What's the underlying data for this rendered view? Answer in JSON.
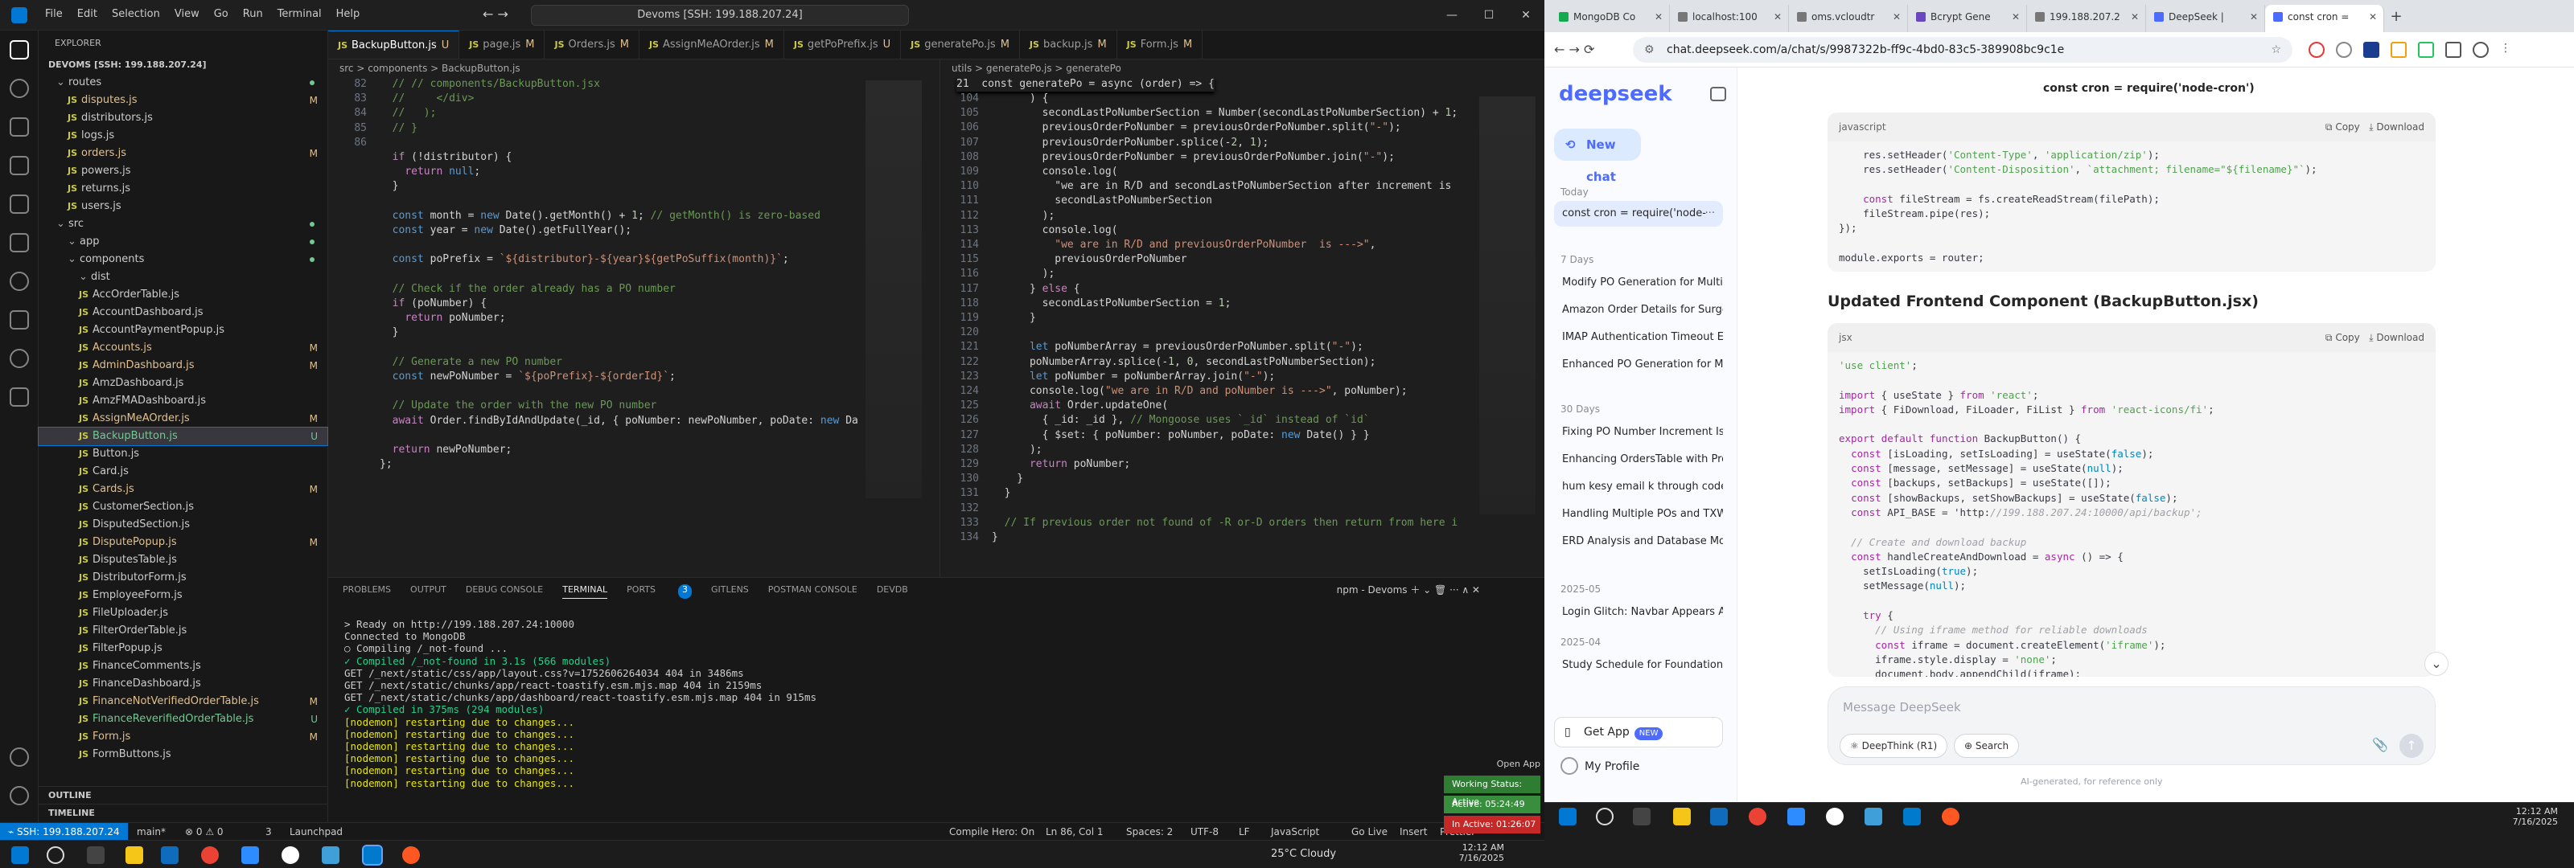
{
  "vscode": {
    "menu": [
      "File",
      "Edit",
      "Selection",
      "View",
      "Go",
      "Run",
      "Terminal",
      "Help"
    ],
    "command_center": "Devoms [SSH: 199.188.207.24]",
    "explorer": {
      "title": "EXPLORER",
      "root": "DEVOMS [SSH: 199.188.207.24]",
      "items": [
        {
          "name": "routes",
          "type": "folder",
          "depth": 1,
          "badge": "dot"
        },
        {
          "name": "disputes.js",
          "type": "js",
          "depth": 2,
          "badge": "M"
        },
        {
          "name": "distributors.js",
          "type": "js",
          "depth": 2,
          "badge": ""
        },
        {
          "name": "logs.js",
          "type": "js",
          "depth": 2,
          "badge": ""
        },
        {
          "name": "orders.js",
          "type": "js",
          "depth": 2,
          "badge": "M"
        },
        {
          "name": "powers.js",
          "type": "js",
          "depth": 2,
          "badge": ""
        },
        {
          "name": "returns.js",
          "type": "js",
          "depth": 2,
          "badge": ""
        },
        {
          "name": "users.js",
          "type": "js",
          "depth": 2,
          "badge": ""
        },
        {
          "name": "src",
          "type": "folder",
          "depth": 1,
          "badge": "dot"
        },
        {
          "name": "app",
          "type": "folder",
          "depth": 2,
          "badge": "dot"
        },
        {
          "name": "components",
          "type": "folder",
          "depth": 2,
          "badge": "dot"
        },
        {
          "name": "dist",
          "type": "folder",
          "depth": 3,
          "badge": ""
        },
        {
          "name": "AccOrderTable.js",
          "type": "js",
          "depth": 3,
          "badge": ""
        },
        {
          "name": "AccountDashboard.js",
          "type": "js",
          "depth": 3,
          "badge": ""
        },
        {
          "name": "AccountPaymentPopup.js",
          "type": "js",
          "depth": 3,
          "badge": ""
        },
        {
          "name": "Accounts.js",
          "type": "js",
          "depth": 3,
          "badge": "M"
        },
        {
          "name": "AdminDashboard.js",
          "type": "js",
          "depth": 3,
          "badge": "M"
        },
        {
          "name": "AmzDashboard.js",
          "type": "js",
          "depth": 3,
          "badge": ""
        },
        {
          "name": "AmzFMADashboard.js",
          "type": "js",
          "depth": 3,
          "badge": ""
        },
        {
          "name": "AssignMeAOrder.js",
          "type": "js",
          "depth": 3,
          "badge": "M"
        },
        {
          "name": "BackupButton.js",
          "type": "js",
          "depth": 3,
          "badge": "U"
        },
        {
          "name": "Button.js",
          "type": "js",
          "depth": 3,
          "badge": ""
        },
        {
          "name": "Card.js",
          "type": "js",
          "depth": 3,
          "badge": ""
        },
        {
          "name": "Cards.js",
          "type": "js",
          "depth": 3,
          "badge": "M"
        },
        {
          "name": "CustomerSection.js",
          "type": "js",
          "depth": 3,
          "badge": ""
        },
        {
          "name": "DisputedSection.js",
          "type": "js",
          "depth": 3,
          "badge": ""
        },
        {
          "name": "DisputePopup.js",
          "type": "js",
          "depth": 3,
          "badge": "M"
        },
        {
          "name": "DisputesTable.js",
          "type": "js",
          "depth": 3,
          "badge": ""
        },
        {
          "name": "DistributorForm.js",
          "type": "js",
          "depth": 3,
          "badge": ""
        },
        {
          "name": "EmployeeForm.js",
          "type": "js",
          "depth": 3,
          "badge": ""
        },
        {
          "name": "FileUploader.js",
          "type": "js",
          "depth": 3,
          "badge": ""
        },
        {
          "name": "FilterOrderTable.js",
          "type": "js",
          "depth": 3,
          "badge": ""
        },
        {
          "name": "FilterPopup.js",
          "type": "js",
          "depth": 3,
          "badge": ""
        },
        {
          "name": "FinanceComments.js",
          "type": "js",
          "depth": 3,
          "badge": ""
        },
        {
          "name": "FinanceDashboard.js",
          "type": "js",
          "depth": 3,
          "badge": ""
        },
        {
          "name": "FinanceNotVerifiedOrderTable.js",
          "type": "js",
          "depth": 3,
          "badge": "M"
        },
        {
          "name": "FinanceReverifiedOrderTable.js",
          "type": "js",
          "depth": 3,
          "badge": "U"
        },
        {
          "name": "Form.js",
          "type": "js",
          "depth": 3,
          "badge": "M"
        },
        {
          "name": "FormButtons.js",
          "type": "js",
          "depth": 3,
          "badge": ""
        }
      ],
      "outline": "OUTLINE",
      "timeline": "TIMELINE"
    },
    "tabs": [
      {
        "label": "BackupButton.js",
        "badge": "U",
        "active": true
      },
      {
        "label": "page.js",
        "badge": "M"
      },
      {
        "label": "Orders.js",
        "badge": "M"
      },
      {
        "label": "AssignMeAOrder.js",
        "badge": "M"
      },
      {
        "label": "getPoPrefix.js",
        "badge": "U"
      },
      {
        "label": "generatePo.js",
        "badge": "M"
      },
      {
        "label": "backup.js",
        "badge": "M"
      },
      {
        "label": "Form.js",
        "badge": "M"
      }
    ],
    "left_breadcrumb": "src > components > BackupButton.js",
    "right_breadcrumb": "utils > generatePo.js > generatePo",
    "left_lines": [
      "82",
      "83",
      "84",
      "85",
      "86",
      "",
      "",
      "",
      "",
      "",
      "",
      "",
      "",
      "",
      "",
      "",
      "",
      "",
      "",
      "",
      "",
      "",
      "",
      "",
      "",
      "",
      "",
      ""
    ],
    "left_code": [
      "  // // components/BackupButton.jsx",
      "  //     </div>",
      "  //   );",
      "  // }",
      "",
      "  if (!distributor) {",
      "    return null;",
      "  }",
      "",
      "  const month = new Date().getMonth() + 1; // getMonth() is zero-based",
      "  const year = new Date().getFullYear();",
      "",
      "  const poPrefix = `${distributor}-${year}${getPoSuffix(month)}`;",
      "",
      "  // Check if the order already has a PO number",
      "  if (poNumber) {",
      "    return poNumber;",
      "  }",
      "",
      "  // Generate a new PO number",
      "  const newPoNumber = `${poPrefix}-${orderId}`;",
      "",
      "  // Update the order with the new PO number",
      "  await Order.findByIdAndUpdate(_id, { poNumber: newPoNumber, poDate: new Da",
      "",
      "  return newPoNumber;",
      "};"
    ],
    "right_start_line": 104,
    "right_header_line": "21  const generatePo = async (order) => {",
    "right_code": [
      "      ) {",
      "        secondLastPoNumberSection = Number(secondLastPoNumberSection) + 1;",
      "        previousOrderPoNumber = previousOrderPoNumber.split(\"-\");",
      "        previousOrderPoNumber.splice(-2, 1);",
      "        previousOrderPoNumber = previousOrderPoNumber.join(\"-\");",
      "        console.log(",
      "          \"we are in R/D and secondLastPoNumberSection after increment is",
      "          secondLastPoNumberSection",
      "        );",
      "        console.log(",
      "          \"we are in R/D and previousOrderPoNumber  is --->\",",
      "          previousOrderPoNumber",
      "        );",
      "      } else {",
      "        secondLastPoNumberSection = 1;",
      "      }",
      "",
      "      let poNumberArray = previousOrderPoNumber.split(\"-\");",
      "      poNumberArray.splice(-1, 0, secondLastPoNumberSection);",
      "      let poNumber = poNumberArray.join(\"-\");",
      "      console.log(\"we are in R/D and poNumber is --->\", poNumber);",
      "      await Order.updateOne(",
      "        { _id: _id }, // Mongoose uses `_id` instead of `id`",
      "        { $set: { poNumber: poNumber, poDate: new Date() } }",
      "      );",
      "      return poNumber;",
      "    }",
      "  }",
      "",
      "  // If previous order not found of -R or-D orders then return from here i",
      "}"
    ],
    "panel_tabs": [
      "PROBLEMS",
      "OUTPUT",
      "DEBUG CONSOLE",
      "TERMINAL",
      "PORTS",
      "GITLENS",
      "POSTMAN CONSOLE",
      "DEVDB"
    ],
    "ports_count": "3",
    "terminal_name": "npm - Devoms",
    "terminal": [
      {
        "t": "> Ready on http://199.188.207.24:10000",
        "c": ""
      },
      {
        "t": "Connected to MongoDB",
        "c": ""
      },
      {
        "t": "○ Compiling /_not-found ...",
        "c": ""
      },
      {
        "t": "✓ Compiled /_not-found in 3.1s (566 modules)",
        "c": "ok"
      },
      {
        "t": "GET /_next/static/css/app/layout.css?v=1752606264034 404 in 3486ms",
        "c": ""
      },
      {
        "t": "GET /_next/static/chunks/app/react-toastify.esm.mjs.map 404 in 2159ms",
        "c": ""
      },
      {
        "t": "GET /_next/static/chunks/app/dashboard/react-toastify.esm.mjs.map 404 in 915ms",
        "c": ""
      },
      {
        "t": "✓ Compiled in 375ms (294 modules)",
        "c": "ok"
      },
      {
        "t": "[nodemon] restarting due to changes...",
        "c": "yl"
      },
      {
        "t": "[nodemon] restarting due to changes...",
        "c": "yl"
      },
      {
        "t": "[nodemon] restarting due to changes...",
        "c": "yl"
      },
      {
        "t": "[nodemon] restarting due to changes...",
        "c": "yl"
      },
      {
        "t": "[nodemon] restarting due to changes...",
        "c": "yl"
      },
      {
        "t": "[nodemon] restarting due to changes...",
        "c": "yl"
      }
    ],
    "status": {
      "remote": "SSH: 199.188.207.24",
      "branch": "main*",
      "errors": "⊗ 0 ⚠ 0",
      "warn": "3",
      "launchpad": "Launchpad",
      "compile": "Compile Hero: On",
      "position": "Ln 86, Col 1",
      "spaces": "Spaces: 2",
      "encoding": "UTF-8",
      "eol": "LF",
      "lang": "JavaScript",
      "golive": "Go Live",
      "insert": "Insert",
      "prettier": "Prettier"
    },
    "timer": {
      "open": "Open App",
      "working": "Working Status: Active",
      "active": "Active: 05:24:49",
      "inactive": "In Active: 01:26:07"
    },
    "taskbar": {
      "weather": "25°C Cloudy",
      "time": "12:12 AM",
      "date": "7/16/2025"
    }
  },
  "browser": {
    "tabs": [
      {
        "label": "MongoDB Co",
        "color": "#13aa52"
      },
      {
        "label": "localhost:100",
        "color": "#777777"
      },
      {
        "label": "oms.vcloudtr",
        "color": "#777777"
      },
      {
        "label": "Bcrypt Gene",
        "color": "#6b46c1"
      },
      {
        "label": "199.188.207.2",
        "color": "#777777"
      },
      {
        "label": "DeepSeek |",
        "color": "#4d6bfe"
      },
      {
        "label": "const cron =",
        "color": "#4d6bfe",
        "active": true
      }
    ],
    "url": "chat.deepseek.com/a/chat/s/9987322b-ff9c-4bd0-83c5-389908bc9c1e"
  },
  "deepseek": {
    "logo": "deepseek",
    "new_chat": "New chat",
    "today": "Today",
    "active_chat": "const cron = require('node-",
    "days7": "7 Days",
    "days7_items": [
      "Modify PO Generation for Multi",
      "Amazon Order Details for Surge",
      "IMAP Authentication Timeout Er",
      "Enhanced PO Generation for Mu"
    ],
    "days30": "30 Days",
    "days30_items": [
      "Fixing PO Number Increment Iss",
      "Enhancing OrdersTable with Pro",
      "hum kesy email k through code",
      "Handling Multiple POs and TXW",
      "ERD Analysis and Database Mod"
    ],
    "month": "2025-05",
    "month_items": [
      "Login Glitch: Navbar Appears Af"
    ],
    "month2": "2025-04",
    "month2_items": [
      "Study Schedule for Foundation"
    ],
    "get_app": "Get App",
    "get_app_badge": "NEW",
    "profile": "My Profile",
    "chat_title": "const cron = require('node-cron')",
    "block1_lang": "javascript",
    "copy": "Copy",
    "download": "Download",
    "block1_code": [
      "    res.setHeader('Content-Type', 'application/zip');",
      "    res.setHeader('Content-Disposition', `attachment; filename=\"${filename}\"`);",
      "",
      "    const fileStream = fs.createReadStream(filePath);",
      "    fileStream.pipe(res);",
      "});",
      "",
      "module.exports = router;"
    ],
    "heading": "Updated Frontend Component (BackupButton.jsx)",
    "block2_lang": "jsx",
    "block2_code": [
      "'use client';",
      "",
      "import { useState } from 'react';",
      "import { FiDownload, FiLoader, FiList } from 'react-icons/fi';",
      "",
      "export default function BackupButton() {",
      "  const [isLoading, setIsLoading] = useState(false);",
      "  const [message, setMessage] = useState(null);",
      "  const [backups, setBackups] = useState([]);",
      "  const [showBackups, setShowBackups] = useState(false);",
      "  const API_BASE = 'http://199.188.207.24:10000/api/backup';",
      "",
      "  // Create and download backup",
      "  const handleCreateAndDownload = async () => {",
      "    setIsLoading(true);",
      "    setMessage(null);",
      "",
      "    try {",
      "      // Using iframe method for reliable downloads",
      "      const iframe = document.createElement('iframe');",
      "      iframe.style.display = 'none';",
      "      document.body.appendChild(iframe);"
    ],
    "input_placeholder": "Message DeepSeek",
    "deepthink": "DeepThink (R1)",
    "search": "Search",
    "disclaimer": "AI-generated, for reference only"
  },
  "right_taskbar": {
    "time": "12:12 AM",
    "date": "7/16/2025"
  }
}
